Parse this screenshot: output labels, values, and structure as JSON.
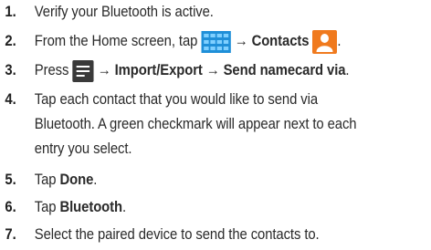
{
  "steps": [
    {
      "num": "1.",
      "text": "Verify your Bluetooth is active."
    },
    {
      "num": "2.",
      "pre": "From the Home screen, tap ",
      "arrow": "→",
      "bold": "Contacts",
      "post": "."
    },
    {
      "num": "3.",
      "pre": "Press ",
      "bold": "→ Import/Export → Send namecard via",
      "post": "."
    },
    {
      "num": "4.",
      "lines": [
        "Tap each contact that you would like to send via",
        "Bluetooth. A green checkmark will appear next to each",
        "entry you select."
      ]
    },
    {
      "num": "5.",
      "pre": "Tap ",
      "bold": "Done",
      "post": "."
    },
    {
      "num": "6.",
      "pre": "Tap ",
      "bold": "Bluetooth",
      "post": "."
    },
    {
      "num": "7.",
      "text": "Select the paired device to send the contacts to."
    }
  ],
  "icons": {
    "apps": "apps-grid-icon",
    "contacts": "contacts-icon",
    "menu": "menu-icon"
  },
  "colors": {
    "text": "#2a2a2a",
    "apps_blue": "#1f8fd8",
    "contacts_orange": "#f07a1e",
    "menu_dark": "#3a3a3a"
  }
}
